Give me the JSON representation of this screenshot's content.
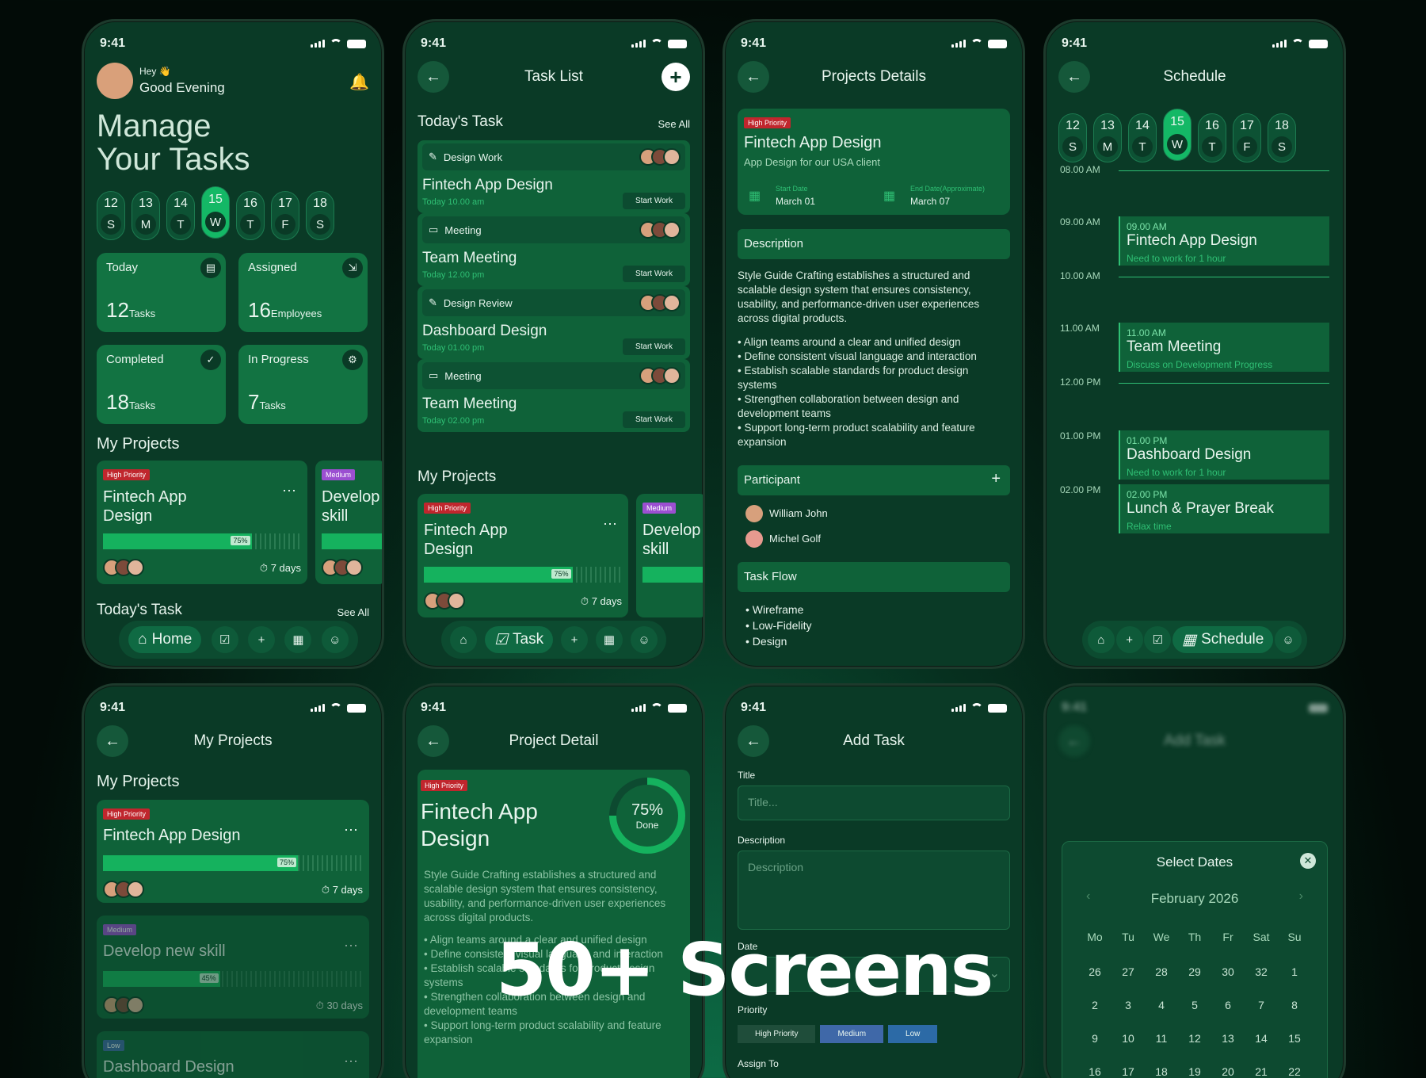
{
  "status_time": "9:41",
  "home": {
    "greeting": "Hey 👋",
    "subgreeting": "Good Evening",
    "title1": "Manage",
    "title2": "Your Tasks",
    "days": [
      {
        "d": "12",
        "w": "S"
      },
      {
        "d": "13",
        "w": "M"
      },
      {
        "d": "14",
        "w": "T"
      },
      {
        "d": "15",
        "w": "W"
      },
      {
        "d": "16",
        "w": "T"
      },
      {
        "d": "17",
        "w": "F"
      },
      {
        "d": "18",
        "w": "S"
      }
    ],
    "stats": [
      {
        "label": "Today",
        "num": "12",
        "unit": "Tasks"
      },
      {
        "label": "Assigned",
        "num": "16",
        "unit": "Employees"
      },
      {
        "label": "Completed",
        "num": "18",
        "unit": "Tasks"
      },
      {
        "label": "In Progress",
        "num": "7",
        "unit": "Tasks"
      }
    ],
    "my_projects": "My Projects",
    "p1_badge": "High Priority",
    "p1_title": "Fintech App Design",
    "p1_pct": "75%",
    "p1_days": "7 days",
    "p1_progress": 0.75,
    "p2_badge": "Medium",
    "p2_title": "Develop skill",
    "todays_task": "Today's Task",
    "see_all": "See All",
    "nav_home": "Home"
  },
  "tasklist": {
    "title": "Task List",
    "todays_task": "Today's Task",
    "see_all": "See All",
    "tasks": [
      {
        "cat": "Design Work",
        "title": "Fintech App Design",
        "time": "Today 10.00 am",
        "btn": "Start Work"
      },
      {
        "cat": "Meeting",
        "title": "Team Meeting",
        "time": "Today 12.00 pm",
        "btn": "Start Work"
      },
      {
        "cat": "Design Review",
        "title": "Dashboard Design",
        "time": "Today 01.00 pm",
        "btn": "Start Work"
      },
      {
        "cat": "Meeting",
        "title": "Team Meeting",
        "time": "Today 02.00 pm",
        "btn": "Start Work"
      }
    ],
    "my_projects": "My Projects",
    "p1_badge": "High Priority",
    "p1_title": "Fintech App Design",
    "p1_pct": "75%",
    "p1_days": "7 days",
    "p2_badge": "Medium",
    "p2_title": "Develop skill",
    "nav_task": "Task"
  },
  "details": {
    "title": "Projects Details",
    "badge": "High Priority",
    "name": "Fintech App Design",
    "sub": "App Design for our USA client",
    "start_label": "Start Date",
    "start": "March 01",
    "end_label": "End Date(Approximate)",
    "end": "March 07",
    "desc_h": "Description",
    "desc": "Style Guide Crafting establishes a structured and scalable design system that ensures consistency, usability, and performance-driven user experiences across digital products.",
    "bullets": [
      "• Align teams around a clear and unified design",
      "• Define consistent visual language and interaction",
      "• Establish scalable standards for product design systems",
      "• Strengthen collaboration between design and development teams",
      "• Support long-term product scalability and feature expansion"
    ],
    "participant_h": "Participant",
    "participants": [
      "William John",
      "Michel Golf"
    ],
    "flow_h": "Task Flow",
    "flow": [
      "Wireframe",
      "Low-Fidelity",
      "Design"
    ]
  },
  "schedule": {
    "title": "Schedule",
    "days": [
      {
        "d": "12",
        "w": "S"
      },
      {
        "d": "13",
        "w": "M"
      },
      {
        "d": "14",
        "w": "T"
      },
      {
        "d": "15",
        "w": "W"
      },
      {
        "d": "16",
        "w": "T"
      },
      {
        "d": "17",
        "w": "F"
      },
      {
        "d": "18",
        "w": "S"
      }
    ],
    "times": [
      "08.00 AM",
      "09.00 AM",
      "10.00 AM",
      "11.00 AM",
      "12.00 PM",
      "01.00 PM",
      "02.00 PM"
    ],
    "events": [
      {
        "t": "09.00 AM",
        "title": "Fintech App Design",
        "sub": "Need to work for 1 hour"
      },
      {
        "t": "11.00 AM",
        "title": "Team Meeting",
        "sub": "Discuss on Development Progress"
      },
      {
        "t": "01.00 PM",
        "title": "Dashboard Design",
        "sub": "Need to work for 1 hour"
      },
      {
        "t": "02.00 PM",
        "title": "Lunch & Prayer Break",
        "sub": "Relax time"
      }
    ],
    "nav_schedule": "Schedule"
  },
  "myprojects": {
    "title": "My Projects",
    "heading": "My Projects",
    "items": [
      {
        "badge": "High Priority",
        "title": "Fintech App Design",
        "pct": "75%",
        "days": "7 days"
      },
      {
        "badge": "Medium",
        "title": "Develop new skill",
        "pct": "45%",
        "days": "30 days"
      },
      {
        "badge": "Low",
        "title": "Dashboard Design"
      }
    ]
  },
  "projdetail": {
    "title": "Project Detail",
    "badge": "High Priority",
    "name1": "Fintech App",
    "name2": "Design",
    "pct": "75%",
    "done": "Done",
    "desc": "Style Guide Crafting establishes a structured and scalable design system that ensures consistency, usability, and performance-driven user experiences across digital products.",
    "bullets": [
      "• Align teams around a clear and unified design",
      "• Define consistent visual language and interaction",
      "• Establish scalable standards for product design systems",
      "• Strengthen collaboration between design and development teams",
      "• Support long-term product scalability and feature expansion"
    ]
  },
  "addtask": {
    "title": "Add Task",
    "title_lbl": "Title",
    "title_ph": "Title...",
    "desc_lbl": "Description",
    "desc_ph": "Description",
    "date_lbl": "Date",
    "prio_lbl": "Priority",
    "prio": [
      "High Priority",
      "Medium",
      "Low"
    ],
    "assign_lbl": "Assign To"
  },
  "dates": {
    "title": "Add Task",
    "modal": "Select Dates",
    "month": "February 2026",
    "wd": [
      "Mo",
      "Tu",
      "We",
      "Th",
      "Fr",
      "Sat",
      "Su"
    ],
    "cells": [
      "26",
      "27",
      "28",
      "29",
      "30",
      "32",
      "1",
      "2",
      "3",
      "4",
      "5",
      "6",
      "7",
      "8",
      "9",
      "10",
      "11",
      "12",
      "13",
      "14",
      "15",
      "16",
      "17",
      "18",
      "19",
      "20",
      "21",
      "22"
    ]
  },
  "headline": "50+ Screens"
}
